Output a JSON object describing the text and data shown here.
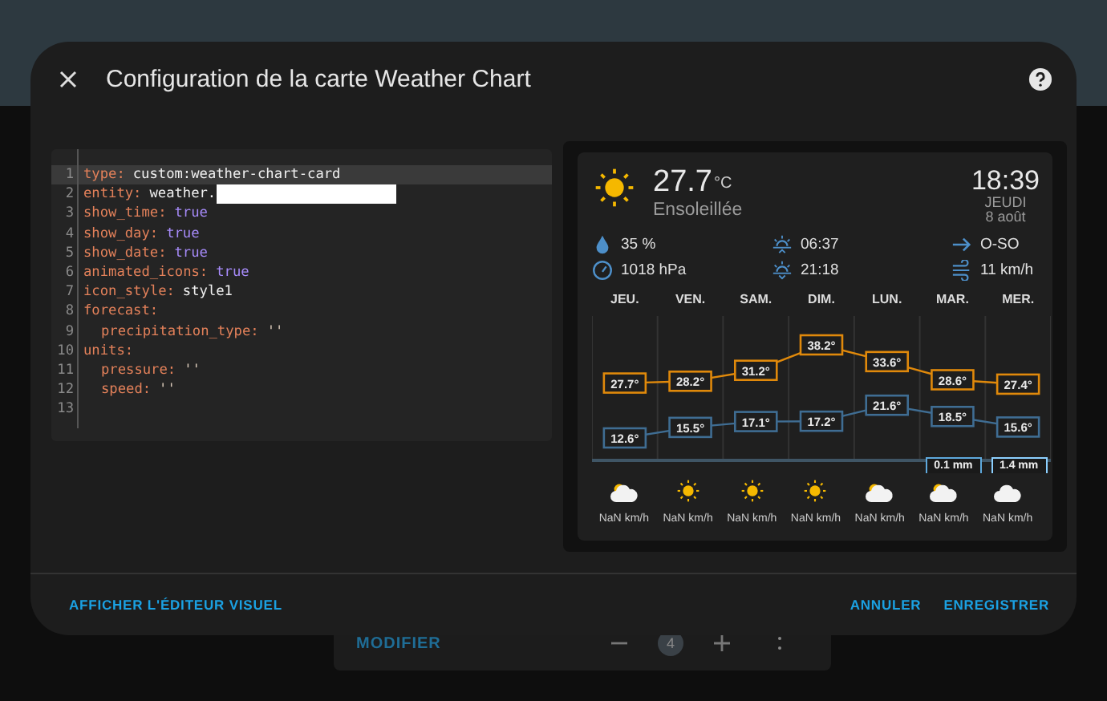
{
  "background": {
    "card": {
      "button": "MODIFIER",
      "count": "4"
    }
  },
  "dialog": {
    "title": "Configuration de la carte Weather Chart",
    "editor": {
      "lines": [
        {
          "number": "1",
          "key": "type:",
          "value": "custom:weather-chart-card",
          "kind": "text",
          "active": true
        },
        {
          "number": "2",
          "key": "entity:",
          "value": "weather.",
          "kind": "text",
          "redacted": true,
          "active": false
        },
        {
          "number": "3",
          "key": "show_time:",
          "value": "true",
          "kind": "bool",
          "active": false
        },
        {
          "number": "4",
          "key": "show_day:",
          "value": "true",
          "kind": "bool",
          "active": false
        },
        {
          "number": "5",
          "key": "show_date:",
          "value": "true",
          "kind": "bool",
          "active": false
        },
        {
          "number": "6",
          "key": "animated_icons:",
          "value": "true",
          "kind": "bool",
          "active": false
        },
        {
          "number": "7",
          "key": "icon_style:",
          "value": "style1",
          "kind": "text",
          "active": false
        },
        {
          "number": "8",
          "key": "forecast:",
          "active": false,
          "children": [
            {
              "number": "9",
              "key": "precipitation_type:",
              "value": "''",
              "kind": "string",
              "active": false
            }
          ]
        },
        {
          "number": "10",
          "key": "units:",
          "active": false,
          "children": [
            {
              "number": "11",
              "key": "pressure:",
              "value": "''",
              "kind": "string",
              "active": false
            },
            {
              "number": "12",
              "key": "speed:",
              "value": "''",
              "kind": "string",
              "active": false
            }
          ]
        },
        {
          "number": "13",
          "active": false
        }
      ]
    },
    "preview": {
      "temperature": "27.7",
      "unit": "°C",
      "condition": "Ensoleillée",
      "time": "18:39",
      "day": "JEUDI",
      "date": "8 août",
      "attributes": [
        {
          "kind": "humidity",
          "text": "35 %"
        },
        {
          "kind": "sunrise",
          "text": "06:37"
        },
        {
          "kind": "wind_direction",
          "text": "O-SO"
        },
        {
          "kind": "pressure",
          "text": "1018 hPa"
        },
        {
          "kind": "sunset",
          "text": "21:18"
        },
        {
          "kind": "wind_speed",
          "text": "11 km/h"
        }
      ],
      "chart_data": {
        "type": "line",
        "categories": [
          "JEU.",
          "VEN.",
          "SAM.",
          "DIM.",
          "LUN.",
          "MAR.",
          "MER."
        ],
        "data_labels": true,
        "series": [
          {
            "color": "#e0890b",
            "marker": "square",
            "values": [
              27.7,
              28.2,
              31.2,
              38.2,
              33.6,
              28.6,
              27.4
            ],
            "value_labels": [
              "27.7°",
              "28.2°",
              "31.2°",
              "38.2°",
              "33.6°",
              "28.6°",
              "27.4°"
            ]
          },
          {
            "color": "#3f6d93",
            "marker": "square",
            "values": [
              12.6,
              15.5,
              17.1,
              17.2,
              21.6,
              18.5,
              15.6
            ],
            "value_labels": [
              "12.6°",
              "15.5°",
              "17.1°",
              "17.2°",
              "21.6°",
              "18.5°",
              "15.6°"
            ]
          }
        ]
      },
      "forecast": [
        {
          "kind": "partly_cloudy",
          "wind": "NaN",
          "wind_unit": "km/h"
        },
        {
          "kind": "sunny",
          "wind": "NaN",
          "wind_unit": "km/h"
        },
        {
          "kind": "sunny",
          "wind": "NaN",
          "wind_unit": "km/h"
        },
        {
          "kind": "sunny",
          "wind": "NaN",
          "wind_unit": "km/h"
        },
        {
          "kind": "partly_cloudy",
          "wind": "NaN",
          "wind_unit": "km/h"
        },
        {
          "kind": "partly_cloudy",
          "wind": "NaN",
          "wind_unit": "km/h",
          "precipitation": "0.1 mm"
        },
        {
          "kind": "cloudy",
          "wind": "NaN",
          "wind_unit": "km/h",
          "precipitation": "1.4 mm"
        }
      ]
    },
    "footer": {
      "left": "AFFICHER L'ÉDITEUR VISUEL",
      "buttons": [
        "ANNULER",
        "ENREGISTRER"
      ]
    }
  }
}
